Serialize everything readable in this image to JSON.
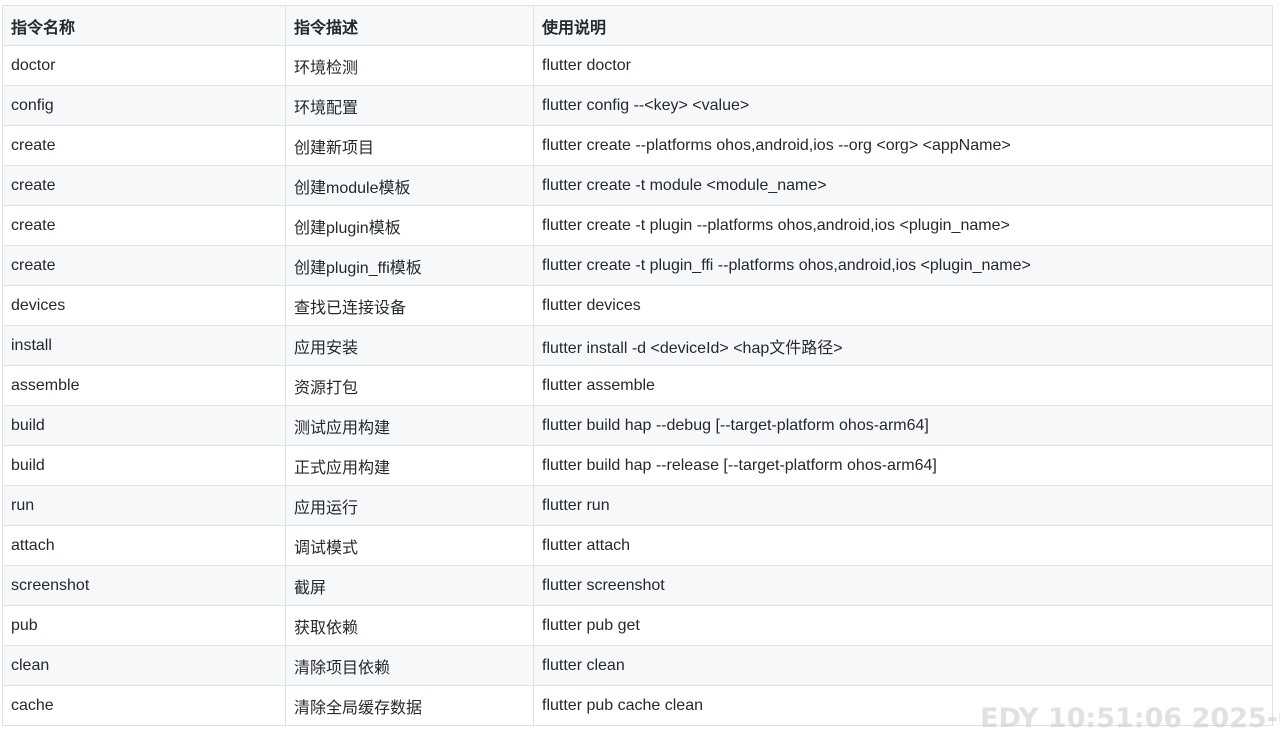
{
  "table": {
    "headers": [
      "指令名称",
      "指令描述",
      "使用说明"
    ],
    "rows": [
      [
        "doctor",
        "环境检测",
        "flutter doctor"
      ],
      [
        "config",
        "环境配置",
        "flutter config --<key> <value>"
      ],
      [
        "create",
        "创建新项目",
        "flutter create --platforms ohos,android,ios --org <org> <appName>"
      ],
      [
        "create",
        "创建module模板",
        "flutter create -t module <module_name>"
      ],
      [
        "create",
        "创建plugin模板",
        "flutter create -t plugin --platforms ohos,android,ios <plugin_name>"
      ],
      [
        "create",
        "创建plugin_ffi模板",
        "flutter create -t plugin_ffi --platforms ohos,android,ios <plugin_name>"
      ],
      [
        "devices",
        "查找已连接设备",
        "flutter devices"
      ],
      [
        "install",
        "应用安装",
        "flutter install -d <deviceId> <hap文件路径>"
      ],
      [
        "assemble",
        "资源打包",
        "flutter assemble"
      ],
      [
        "build",
        "测试应用构建",
        "flutter build hap --debug [--target-platform ohos-arm64]"
      ],
      [
        "build",
        "正式应用构建",
        "flutter build hap --release [--target-platform ohos-arm64]"
      ],
      [
        "run",
        "应用运行",
        "flutter run"
      ],
      [
        "attach",
        "调试模式",
        "flutter attach"
      ],
      [
        "screenshot",
        "截屏",
        "flutter screenshot"
      ],
      [
        "pub",
        "获取依赖",
        "flutter pub get"
      ],
      [
        "clean",
        "清除项目依赖",
        "flutter clean"
      ],
      [
        "cache",
        "清除全局缓存数据",
        "flutter pub cache clean"
      ]
    ]
  },
  "watermark": "EDY  10:51:06  2025-0"
}
